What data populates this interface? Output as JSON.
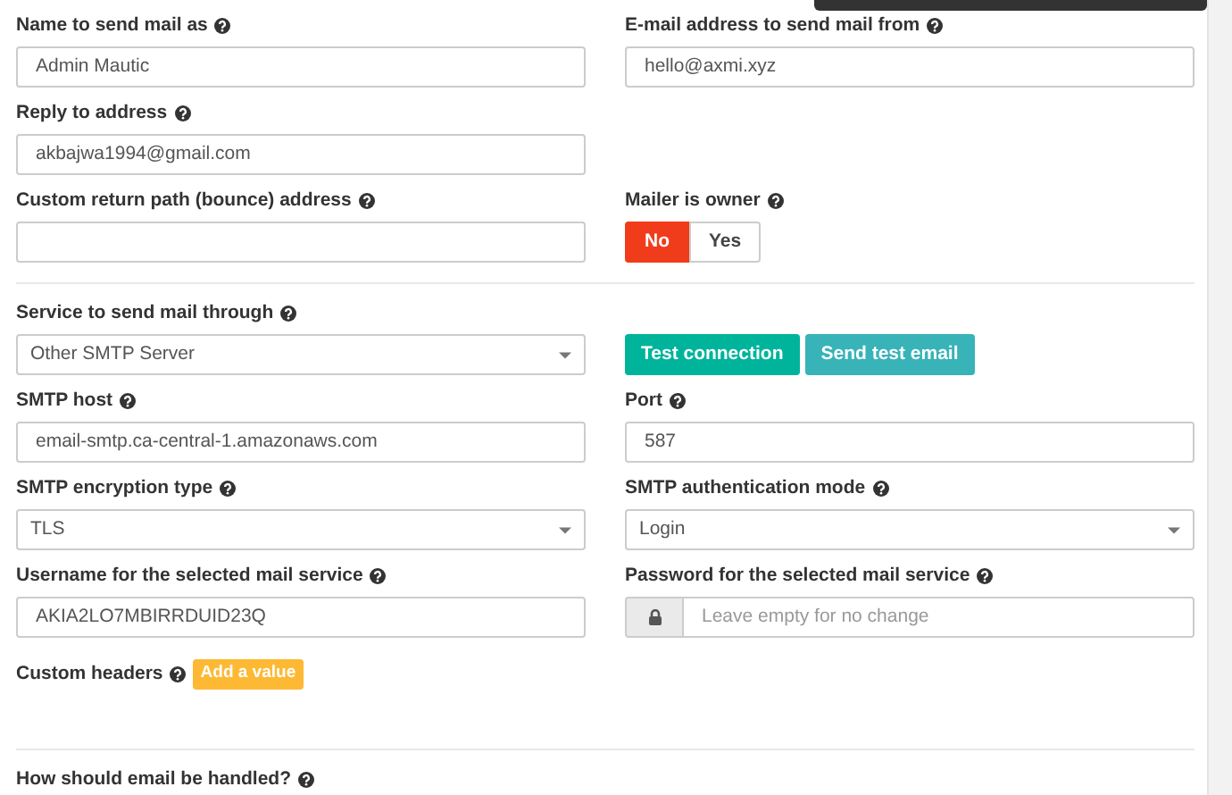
{
  "sections": [
    {
      "rows": [
        [
          {
            "kind": "text",
            "label": "Name to send mail as",
            "value": "Admin Mautic"
          },
          {
            "kind": "text",
            "label": "E-mail address to send mail from",
            "value": "hello@axmi.xyz"
          }
        ],
        [
          {
            "kind": "text",
            "label": "Reply to address",
            "value": "akbajwa1994@gmail.com"
          }
        ],
        [
          {
            "kind": "text",
            "label": "Custom return path (bounce) address"
          },
          {
            "kind": "toggle",
            "label": "Mailer is owner",
            "options": [
              {
                "label": "No",
                "selected": true
              },
              {
                "label": "Yes",
                "selected": false
              }
            ]
          }
        ]
      ]
    },
    {
      "rows": [
        [
          {
            "kind": "select",
            "label": "Service to send mail through",
            "value": "Other SMTP Server"
          },
          {
            "kind": "buttons",
            "buttons": [
              {
                "label": "Test connection"
              },
              {
                "label": "Send test email"
              }
            ]
          }
        ],
        [
          {
            "kind": "text",
            "label": "SMTP host",
            "value": "email-smtp.ca-central-1.amazonaws.com"
          },
          {
            "kind": "text",
            "label": "Port",
            "value": "587"
          }
        ],
        [
          {
            "kind": "select",
            "label": "SMTP encryption type",
            "value": "TLS"
          },
          {
            "kind": "select",
            "label": "SMTP authentication mode",
            "value": "Login"
          }
        ],
        [
          {
            "kind": "text",
            "label": "Username for the selected mail service",
            "value": "AKIA2LO7MBIRRDUID23Q"
          },
          {
            "kind": "password",
            "label": "Password for the selected mail service",
            "placeholder": "Leave empty for no change"
          }
        ],
        [
          {
            "kind": "add",
            "label": "Custom headers",
            "button": "Add a value"
          }
        ]
      ]
    },
    {
      "rows": [
        [
          {
            "kind": "heading",
            "label": "How should email be handled?"
          }
        ]
      ]
    }
  ]
}
